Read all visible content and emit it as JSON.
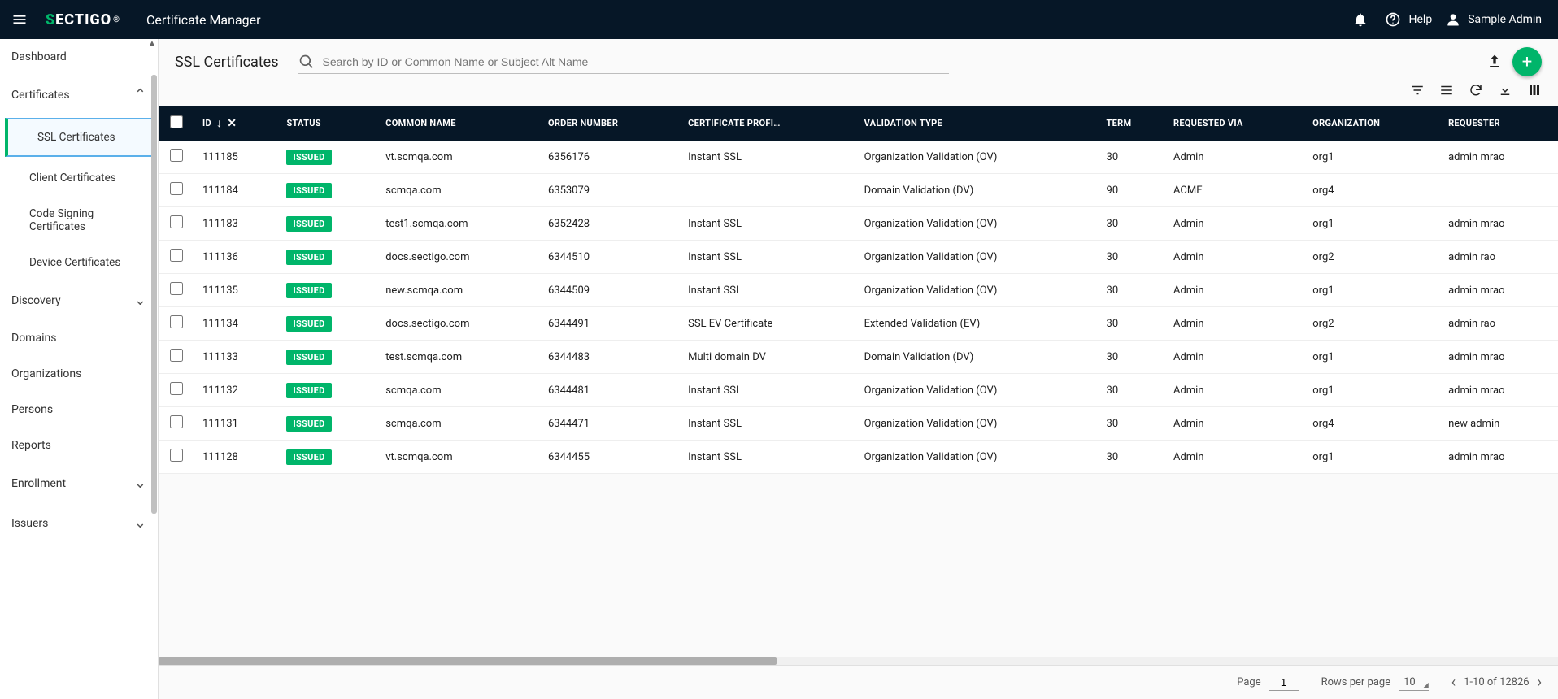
{
  "app": {
    "brand_pre": "S",
    "brand_mid": "ECTIGO",
    "brand_suffix": "®",
    "title": "Certificate Manager"
  },
  "header": {
    "help": "Help",
    "user": "Sample Admin"
  },
  "sidebar": {
    "items": [
      {
        "label": "Dashboard",
        "expand": ""
      },
      {
        "label": "Certificates",
        "expand": "up"
      },
      {
        "label": "Discovery",
        "expand": "down"
      },
      {
        "label": "Domains",
        "expand": ""
      },
      {
        "label": "Organizations",
        "expand": ""
      },
      {
        "label": "Persons",
        "expand": ""
      },
      {
        "label": "Reports",
        "expand": ""
      },
      {
        "label": "Enrollment",
        "expand": "down"
      },
      {
        "label": "Issuers",
        "expand": "down"
      }
    ],
    "cert_sub": [
      {
        "label": "SSL Certificates",
        "active": true
      },
      {
        "label": "Client Certificates"
      },
      {
        "label": "Code Signing Certificates"
      },
      {
        "label": "Device Certificates"
      }
    ]
  },
  "page": {
    "title": "SSL Certificates",
    "search_placeholder": "Search by ID or Common Name or Subject Alt Name"
  },
  "columns": [
    "ID",
    "STATUS",
    "COMMON NAME",
    "ORDER NUMBER",
    "CERTIFICATE PROFI…",
    "VALIDATION TYPE",
    "TERM",
    "REQUESTED VIA",
    "ORGANIZATION",
    "REQUESTER"
  ],
  "rows": [
    {
      "id": "111185",
      "status": "ISSUED",
      "cn": "vt.scmqa.com",
      "order": "6356176",
      "profile": "Instant SSL",
      "vtype": "Organization Validation (OV)",
      "term": "30",
      "via": "Admin",
      "org": "org1",
      "req": "admin mrao"
    },
    {
      "id": "111184",
      "status": "ISSUED",
      "cn": "scmqa.com",
      "order": "6353079",
      "profile": "",
      "vtype": "Domain Validation (DV)",
      "term": "90",
      "via": "ACME",
      "org": "org4",
      "req": ""
    },
    {
      "id": "111183",
      "status": "ISSUED",
      "cn": "test1.scmqa.com",
      "order": "6352428",
      "profile": "Instant SSL",
      "vtype": "Organization Validation (OV)",
      "term": "30",
      "via": "Admin",
      "org": "org1",
      "req": "admin mrao"
    },
    {
      "id": "111136",
      "status": "ISSUED",
      "cn": "docs.sectigo.com",
      "order": "6344510",
      "profile": "Instant SSL",
      "vtype": "Organization Validation (OV)",
      "term": "30",
      "via": "Admin",
      "org": "org2",
      "req": "admin rao"
    },
    {
      "id": "111135",
      "status": "ISSUED",
      "cn": "new.scmqa.com",
      "order": "6344509",
      "profile": "Instant SSL",
      "vtype": "Organization Validation (OV)",
      "term": "30",
      "via": "Admin",
      "org": "org1",
      "req": "admin mrao"
    },
    {
      "id": "111134",
      "status": "ISSUED",
      "cn": "docs.sectigo.com",
      "order": "6344491",
      "profile": "SSL EV Certificate",
      "vtype": "Extended Validation (EV)",
      "term": "30",
      "via": "Admin",
      "org": "org2",
      "req": "admin rao"
    },
    {
      "id": "111133",
      "status": "ISSUED",
      "cn": "test.scmqa.com",
      "order": "6344483",
      "profile": "Multi domain DV",
      "vtype": "Domain Validation (DV)",
      "term": "30",
      "via": "Admin",
      "org": "org1",
      "req": "admin mrao"
    },
    {
      "id": "111132",
      "status": "ISSUED",
      "cn": "scmqa.com",
      "order": "6344481",
      "profile": "Instant SSL",
      "vtype": "Organization Validation (OV)",
      "term": "30",
      "via": "Admin",
      "org": "org1",
      "req": "admin mrao"
    },
    {
      "id": "111131",
      "status": "ISSUED",
      "cn": "scmqa.com",
      "order": "6344471",
      "profile": "Instant SSL",
      "vtype": "Organization Validation (OV)",
      "term": "30",
      "via": "Admin",
      "org": "org4",
      "req": "new admin"
    },
    {
      "id": "111128",
      "status": "ISSUED",
      "cn": "vt.scmqa.com",
      "order": "6344455",
      "profile": "Instant SSL",
      "vtype": "Organization Validation (OV)",
      "term": "30",
      "via": "Admin",
      "org": "org1",
      "req": "admin mrao"
    }
  ],
  "pager": {
    "page_lbl": "Page",
    "page": "1",
    "rpp_lbl": "Rows per page",
    "rpp": "10",
    "range": "1-10 of 12826"
  }
}
